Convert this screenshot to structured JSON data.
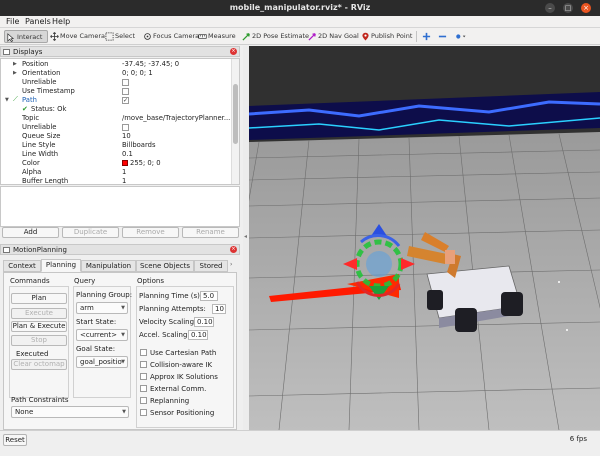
{
  "window": {
    "title": "mobile_manipulator.rviz* - RViz"
  },
  "menu": [
    "File",
    "Panels",
    "Help"
  ],
  "toolbar": {
    "tools": [
      {
        "label": "Interact",
        "icon": "interact-icon",
        "active": true
      },
      {
        "label": "Move Camera",
        "icon": "move-camera-icon"
      },
      {
        "label": "Select",
        "icon": "select-icon"
      },
      {
        "label": "Focus Camera",
        "icon": "focus-camera-icon"
      },
      {
        "label": "Measure",
        "icon": "measure-icon"
      },
      {
        "label": "2D Pose Estimate",
        "icon": "pose-estimate-icon",
        "color": "#2e9b2e"
      },
      {
        "label": "2D Nav Goal",
        "icon": "nav-goal-icon",
        "color": "#b01cc8"
      },
      {
        "label": "Publish Point",
        "icon": "publish-point-icon",
        "color": "#c0271d"
      }
    ],
    "extra_icons": [
      "add-tool-icon",
      "remove-tool-icon",
      "camera-type-icon"
    ]
  },
  "displays": {
    "title": "Displays",
    "rows": [
      {
        "key": "Position",
        "value": "-37.45; -37.45; 0",
        "indent": 2,
        "arrow": true
      },
      {
        "key": "Orientation",
        "value": "0; 0; 0; 1",
        "indent": 2,
        "arrow": true
      },
      {
        "key": "Unreliable",
        "check": false,
        "indent": 2
      },
      {
        "key": "Use Timestamp",
        "check": false,
        "indent": 2
      },
      {
        "key": "Path",
        "check": true,
        "indent": 1,
        "arrow": "open",
        "path_icon": true,
        "key_color": "#1a5fb4"
      },
      {
        "key": "Status: Ok",
        "indent": 2,
        "status_ok": true
      },
      {
        "key": "Topic",
        "value": "/move_base/TrajectoryPlanner...",
        "indent": 2
      },
      {
        "key": "Unreliable",
        "check": false,
        "indent": 2
      },
      {
        "key": "Queue Size",
        "value": "10",
        "indent": 2
      },
      {
        "key": "Line Style",
        "value": "Billboards",
        "indent": 2
      },
      {
        "key": "Line Width",
        "value": "0.1",
        "indent": 2
      },
      {
        "key": "Color",
        "value": "255; 0; 0",
        "indent": 2,
        "swatch": true
      },
      {
        "key": "Alpha",
        "value": "1",
        "indent": 2
      },
      {
        "key": "Buffer Length",
        "value": "1",
        "indent": 2
      }
    ],
    "buttons": {
      "add": "Add",
      "duplicate": "Duplicate",
      "remove": "Remove",
      "rename": "Rename"
    }
  },
  "motion_planning": {
    "title": "MotionPlanning",
    "tabs": [
      "Context",
      "Planning",
      "Manipulation",
      "Scene Objects",
      "Stored"
    ],
    "selected_tab": 1,
    "commands": {
      "title": "Commands",
      "plan": "Plan",
      "execute": "Execute",
      "plan_execute": "Plan & Execute",
      "stop": "Stop",
      "executed": "Executed",
      "clear_octomap": "Clear octomap"
    },
    "query": {
      "title": "Query",
      "planning_group_label": "Planning Group:",
      "planning_group": "arm",
      "start_state_label": "Start State:",
      "start_state": "<current>",
      "goal_state_label": "Goal State:",
      "goal_state": "goal_positio"
    },
    "options": {
      "title": "Options",
      "planning_time_label": "Planning Time (s):",
      "planning_time": "5.0",
      "planning_attempts_label": "Planning Attempts:",
      "planning_attempts": "10",
      "velocity_scaling_label": "Velocity Scaling:",
      "velocity_scaling": "0.10",
      "accel_scaling_label": "Accel. Scaling:",
      "accel_scaling": "0.10",
      "checks": [
        "Use Cartesian Path",
        "Collision-aware IK",
        "Approx IK Solutions",
        "External Comm.",
        "Replanning",
        "Sensor Positioning"
      ]
    },
    "path_constraints": {
      "label": "Path Constraints",
      "value": "None"
    }
  },
  "status": {
    "reset": "Reset",
    "fps": "6 fps"
  },
  "scene": {
    "background": "#2e2e2e",
    "grid": "#6d6d6d",
    "path_color": "#ff0000",
    "costmap_color": "#1f3bd6"
  }
}
